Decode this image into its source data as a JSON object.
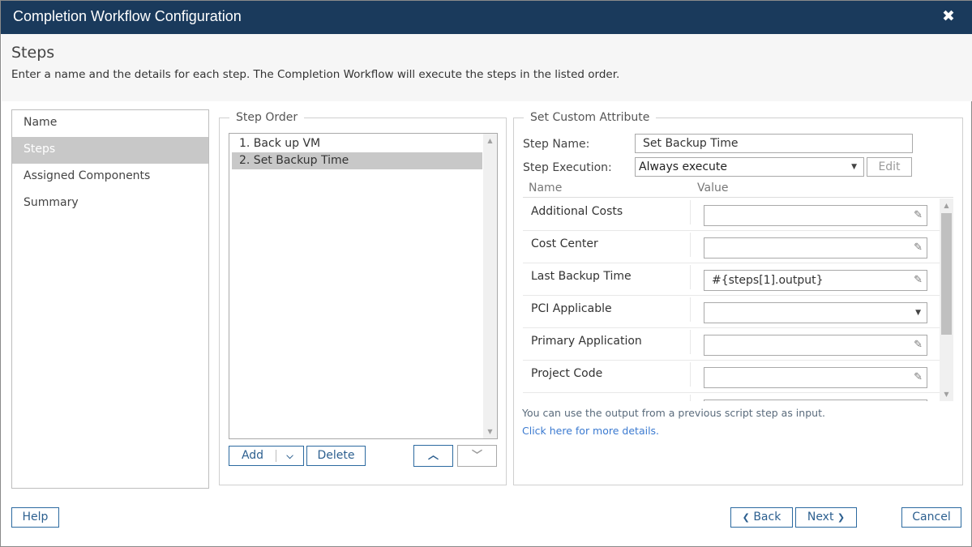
{
  "window": {
    "title": "Completion Workflow Configuration",
    "close_icon": "close-icon"
  },
  "header": {
    "title": "Steps",
    "description": "Enter a name and the details for each step. The Completion Workflow will execute the steps in the listed order."
  },
  "nav": {
    "items": [
      {
        "label": "Name",
        "active": false
      },
      {
        "label": "Steps",
        "active": true
      },
      {
        "label": "Assigned Components",
        "active": false
      },
      {
        "label": "Summary",
        "active": false
      }
    ]
  },
  "step_order": {
    "legend": "Step Order",
    "steps": [
      {
        "label": "1. Back up VM",
        "selected": false
      },
      {
        "label": "2. Set Backup Time",
        "selected": true
      }
    ],
    "buttons": {
      "add": "Add",
      "delete": "Delete",
      "move_up_icon": "chevron-up-icon",
      "move_down_icon": "chevron-down-icon"
    }
  },
  "custom_attribute": {
    "legend": "Set Custom Attribute",
    "step_name_label": "Step Name:",
    "step_name_value": "Set Backup Time",
    "step_execution_label": "Step Execution:",
    "step_execution_value": "Always execute",
    "edit_button": "Edit",
    "grid": {
      "columns": [
        "Name",
        "Value"
      ],
      "rows": [
        {
          "name": "Additional Costs",
          "value": "",
          "type": "text"
        },
        {
          "name": "Cost Center",
          "value": "",
          "type": "text"
        },
        {
          "name": "Last Backup Time",
          "value": "#{steps[1].output}",
          "type": "text"
        },
        {
          "name": "PCI Applicable",
          "value": "",
          "type": "select"
        },
        {
          "name": "Primary Application",
          "value": "",
          "type": "text"
        },
        {
          "name": "Project Code",
          "value": "",
          "type": "text"
        },
        {
          "name": "",
          "value": "",
          "type": "text"
        }
      ]
    },
    "hint": "You can use the output from a previous script step as input.",
    "link": "Click here for more details."
  },
  "footer": {
    "help": "Help",
    "back": "Back",
    "next": "Next",
    "cancel": "Cancel"
  },
  "colors": {
    "titlebar": "#1a3a5c",
    "button_border": "#2c6aa0",
    "selection": "#c8c8c8",
    "link": "#3b7ad0"
  }
}
